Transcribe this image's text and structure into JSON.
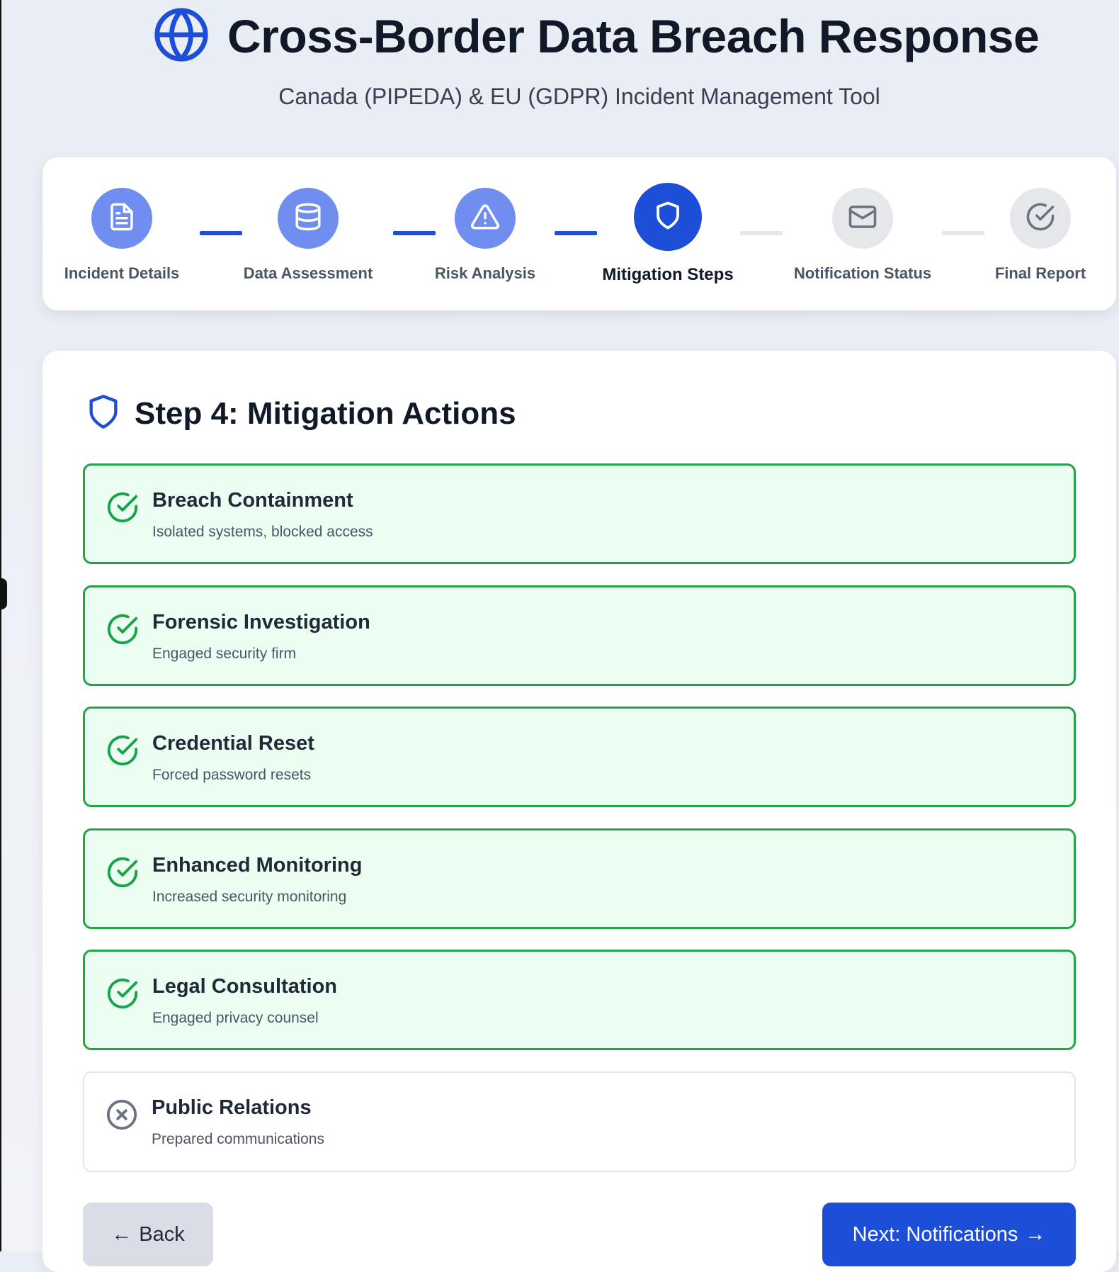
{
  "header": {
    "title": "Cross-Border Data Breach Response",
    "subtitle": "Canada (PIPEDA) & EU (GDPR) Incident Management Tool",
    "logo_icon": "globe-icon"
  },
  "progress": {
    "steps": [
      {
        "label": "Incident Details",
        "icon": "document-icon",
        "state": "done"
      },
      {
        "label": "Data Assessment",
        "icon": "database-icon",
        "state": "done"
      },
      {
        "label": "Risk Analysis",
        "icon": "warning-icon",
        "state": "done"
      },
      {
        "label": "Mitigation Steps",
        "icon": "shield-icon",
        "state": "active"
      },
      {
        "label": "Notification Status",
        "icon": "mail-icon",
        "state": "pending"
      },
      {
        "label": "Final Report",
        "icon": "check-circle-icon",
        "state": "pending"
      }
    ]
  },
  "section": {
    "title": "Step 4: Mitigation Actions",
    "icon": "shield-icon",
    "actions": [
      {
        "title": "Breach Containment",
        "description": "Isolated systems, blocked access",
        "completed": true
      },
      {
        "title": "Forensic Investigation",
        "description": "Engaged security firm",
        "completed": true
      },
      {
        "title": "Credential Reset",
        "description": "Forced password resets",
        "completed": true
      },
      {
        "title": "Enhanced Monitoring",
        "description": "Increased security monitoring",
        "completed": true
      },
      {
        "title": "Legal Consultation",
        "description": "Engaged privacy counsel",
        "completed": true
      },
      {
        "title": "Public Relations",
        "description": "Prepared communications",
        "completed": false
      }
    ]
  },
  "navigation": {
    "back_label": "Back",
    "back_arrow": "←",
    "next_label": "Next: Notifications",
    "next_arrow": "→"
  },
  "colors": {
    "primary": "#1d4ed8",
    "step_done": "#6f8ef0",
    "step_pending": "#e5e7eb",
    "success_border": "#22a447",
    "success_bg": "#ecfdf1",
    "muted_icon": "#6b7280"
  }
}
